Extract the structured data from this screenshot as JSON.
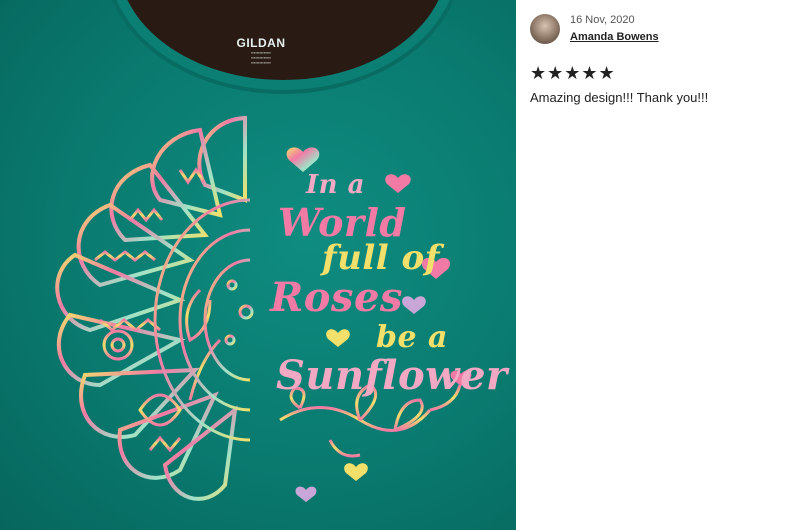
{
  "photo": {
    "shirt_label": "GILDAN",
    "quote": [
      "In a",
      "World",
      "full of",
      "Roses",
      "be a",
      "Sunflower"
    ]
  },
  "review": {
    "date": "16 Nov, 2020",
    "reviewer": "Amanda Bowens",
    "stars": "★★★★★",
    "comment": "Amazing design!!! Thank you!!!"
  },
  "colors": {
    "shirt": "#0a7a6f",
    "print_pink": "#f27aa5",
    "print_yellow": "#f2e06a",
    "print_mint": "#9fe2c8"
  }
}
